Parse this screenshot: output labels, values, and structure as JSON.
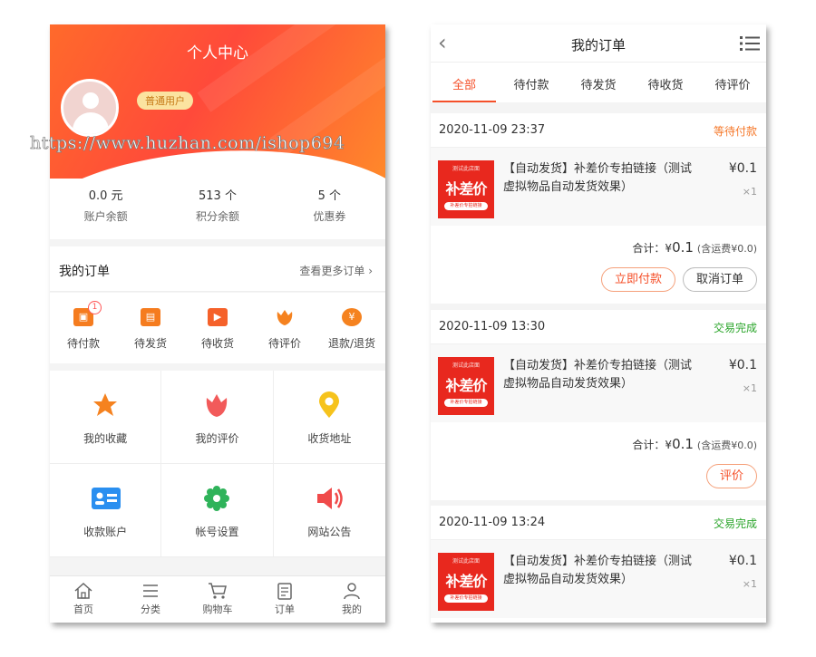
{
  "left": {
    "title": "个人中心",
    "user_badge": "普通用户",
    "watermark": "https://www.huzhan.com/ishop694",
    "stats": [
      {
        "value": "0.0 元",
        "label": "账户余额"
      },
      {
        "value": "513 个",
        "label": "积分余额"
      },
      {
        "value": "5 个",
        "label": "优惠券"
      }
    ],
    "orders": {
      "title": "我的订单",
      "more": "查看更多订单 ›",
      "items": [
        {
          "label": "待付款",
          "badge": "1",
          "icon": "wallet-icon"
        },
        {
          "label": "待发货",
          "icon": "box-icon"
        },
        {
          "label": "待收货",
          "icon": "truck-icon"
        },
        {
          "label": "待评价",
          "icon": "flower-icon"
        },
        {
          "label": "退款/退货",
          "icon": "refund-icon"
        }
      ]
    },
    "grid": [
      {
        "label": "我的收藏",
        "icon": "star-icon"
      },
      {
        "label": "我的评价",
        "icon": "tulip-icon"
      },
      {
        "label": "收货地址",
        "icon": "location-pin-icon"
      },
      {
        "label": "收款账户",
        "icon": "id-card-icon"
      },
      {
        "label": "帐号设置",
        "icon": "gear-icon"
      },
      {
        "label": "网站公告",
        "icon": "speaker-icon"
      }
    ],
    "tabbar": [
      {
        "label": "首页",
        "icon": "home-icon"
      },
      {
        "label": "分类",
        "icon": "list-icon"
      },
      {
        "label": "购物车",
        "icon": "cart-icon"
      },
      {
        "label": "订单",
        "icon": "order-icon"
      },
      {
        "label": "我的",
        "icon": "user-icon"
      }
    ],
    "icon_glyphs": {
      "wallet": "▣",
      "box": "▤",
      "truck": "▶",
      "refund": "¥"
    }
  },
  "right": {
    "title": "我的订单",
    "back": "‹",
    "tabs": [
      "全部",
      "待付款",
      "待发货",
      "待收货",
      "待评价"
    ],
    "active_tab": 0,
    "thumb": {
      "small": "测试此店面",
      "big": "补差价",
      "pill": "补差价专拍链接"
    },
    "orders": [
      {
        "date": "2020-11-09 23:37",
        "status": "等待付款",
        "status_color": "#f5782a",
        "name": "【自动发货】补差价专拍链接（测试虚拟物品自动发货效果）",
        "price": "¥0.1",
        "qty": "×1",
        "total_label": "合计：¥",
        "total_amount": "0.1",
        "shipping": "(含运费¥0.0)",
        "buttons": [
          "立即付款",
          "取消订单"
        ]
      },
      {
        "date": "2020-11-09 13:30",
        "status": "交易完成",
        "status_color": "#2aa52a",
        "name": "【自动发货】补差价专拍链接（测试虚拟物品自动发货效果）",
        "price": "¥0.1",
        "qty": "×1",
        "total_label": "合计：¥",
        "total_amount": "0.1",
        "shipping": "(含运费¥0.0)",
        "buttons": [
          "评价"
        ]
      },
      {
        "date": "2020-11-09 13:24",
        "status": "交易完成",
        "status_color": "#2aa52a",
        "name": "【自动发货】补差价专拍链接（测试虚拟物品自动发货效果）",
        "price": "¥0.1",
        "qty": "×1"
      }
    ]
  },
  "colors": {
    "accent": "#f5502a",
    "success": "#2aa52a",
    "pending": "#f5782a"
  }
}
